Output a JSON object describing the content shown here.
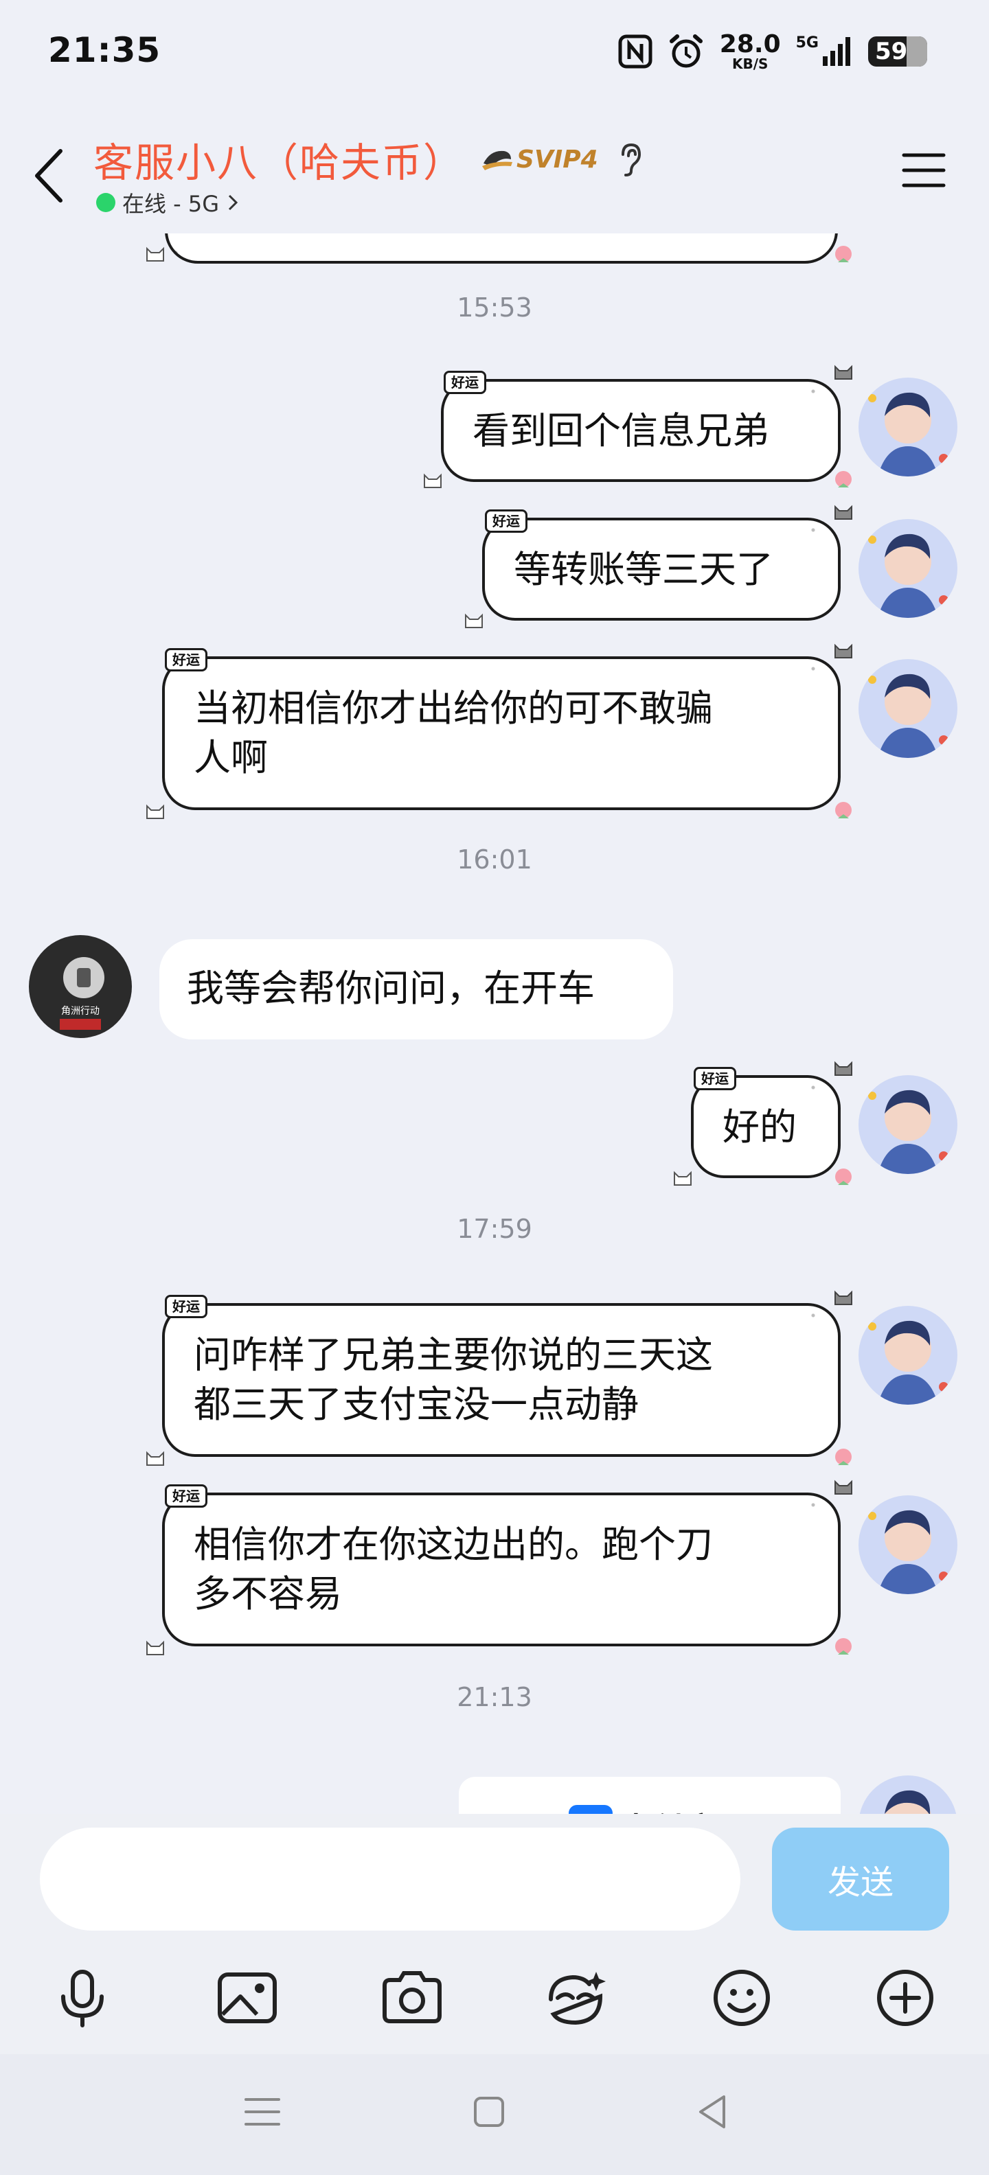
{
  "status_bar": {
    "time": "21:35",
    "net_speed_value": "28.0",
    "net_speed_unit": "KB/S",
    "network": "5G",
    "battery": "59",
    "icons": [
      "nfc-icon",
      "alarm-icon",
      "signal-icon",
      "battery-icon"
    ]
  },
  "header": {
    "title": "客服小八（哈夫币）",
    "badge": "SVIP4",
    "status": "在线 - 5G",
    "colors": {
      "title": "#f25a3c",
      "online": "#2bd46b",
      "badge": "#c0822b"
    }
  },
  "messages": [
    {
      "type": "time",
      "text": "15:53"
    },
    {
      "type": "message",
      "side": "right",
      "tag": "好运",
      "lines": [
        "看到回个信息兄弟"
      ]
    },
    {
      "type": "message",
      "side": "right",
      "tag": "好运",
      "lines": [
        "等转账等三天了"
      ]
    },
    {
      "type": "message",
      "side": "right",
      "tag": "好运",
      "lines": [
        "当初相信你才出给你的可不敢骗",
        "人啊"
      ]
    },
    {
      "type": "time",
      "text": "16:01"
    },
    {
      "type": "message",
      "side": "left",
      "lines": [
        "我等会帮你问问，在开车"
      ],
      "avatar_text": "角洲行动"
    },
    {
      "type": "message",
      "side": "right",
      "tag": "好运",
      "lines": [
        "好的"
      ]
    },
    {
      "type": "time",
      "text": "17:59"
    },
    {
      "type": "message",
      "side": "right",
      "tag": "好运",
      "lines": [
        "问咋样了兄弟主要你说的三天这",
        "都三天了支付宝没一点动静"
      ]
    },
    {
      "type": "message",
      "side": "right",
      "tag": "好运",
      "lines": [
        "相信你才在你这边出的。跑个刀",
        "多不容易"
      ]
    },
    {
      "type": "time",
      "text": "21:13"
    },
    {
      "type": "message",
      "side": "right",
      "card": "支付宝"
    }
  ],
  "input": {
    "placeholder": "",
    "value": "",
    "send_label": "发送"
  },
  "toolbar": [
    "microphone-icon",
    "image-icon",
    "camera-icon",
    "sticker-face-icon",
    "emoji-icon",
    "plus-icon"
  ],
  "nav": [
    "menu-nav-icon",
    "home-nav-icon",
    "back-nav-icon"
  ]
}
